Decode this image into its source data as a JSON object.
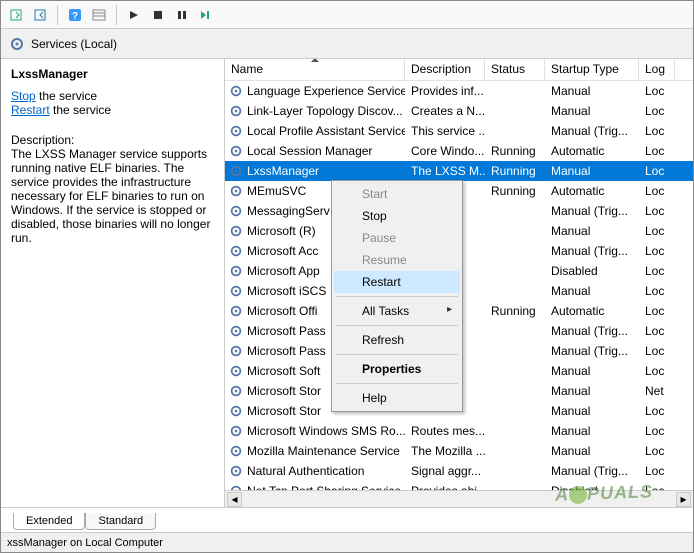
{
  "toolbar": {
    "icons": [
      "export",
      "import",
      "sep",
      "help",
      "props",
      "sep",
      "play",
      "stop",
      "pause",
      "restart"
    ]
  },
  "header": {
    "title": "Services (Local)"
  },
  "left": {
    "title": "LxssManager",
    "stop_label": "Stop",
    "stop_suffix": " the service",
    "restart_label": "Restart",
    "restart_suffix": " the service",
    "desc_label": "Description:",
    "desc_text": "The LXSS Manager service supports running native ELF binaries. The service provides the infrastructure necessary for ELF binaries to run on Windows. If the service is stopped or disabled, those binaries will no longer run."
  },
  "columns": [
    "Name",
    "Description",
    "Status",
    "Startup Type",
    "Log"
  ],
  "rows": [
    {
      "name": "Language Experience Service",
      "desc": "Provides inf...",
      "status": "",
      "startup": "Manual",
      "log": "Loc"
    },
    {
      "name": "Link-Layer Topology Discov...",
      "desc": "Creates a N...",
      "status": "",
      "startup": "Manual",
      "log": "Loc"
    },
    {
      "name": "Local Profile Assistant Service",
      "desc": "This service ...",
      "status": "",
      "startup": "Manual (Trig...",
      "log": "Loc"
    },
    {
      "name": "Local Session Manager",
      "desc": "Core Windo...",
      "status": "Running",
      "startup": "Automatic",
      "log": "Loc"
    },
    {
      "name": "LxssManager",
      "desc": "The LXSS M...",
      "status": "Running",
      "startup": "Manual",
      "log": "Loc",
      "selected": true
    },
    {
      "name": "MEmuSVC",
      "desc": "",
      "status": "Running",
      "startup": "Automatic",
      "log": "Loc"
    },
    {
      "name": "MessagingServ",
      "desc": "",
      "status": "",
      "startup": "Manual (Trig...",
      "log": "Loc"
    },
    {
      "name": "Microsoft (R) ",
      "desc": "",
      "status": "",
      "startup": "Manual",
      "log": "Loc"
    },
    {
      "name": "Microsoft Acc",
      "desc": "",
      "status": "",
      "startup": "Manual (Trig...",
      "log": "Loc"
    },
    {
      "name": "Microsoft App",
      "desc": "",
      "status": "",
      "startup": "Disabled",
      "log": "Loc"
    },
    {
      "name": "Microsoft iSCS",
      "desc": "",
      "status": "",
      "startup": "Manual",
      "log": "Loc"
    },
    {
      "name": "Microsoft Offi",
      "desc": "",
      "status": "Running",
      "startup": "Automatic",
      "log": "Loc"
    },
    {
      "name": "Microsoft Pass",
      "desc": "",
      "status": "",
      "startup": "Manual (Trig...",
      "log": "Loc"
    },
    {
      "name": "Microsoft Pass",
      "desc": "",
      "status": "",
      "startup": "Manual (Trig...",
      "log": "Loc"
    },
    {
      "name": "Microsoft Soft",
      "desc": "",
      "status": "",
      "startup": "Manual",
      "log": "Loc"
    },
    {
      "name": "Microsoft Stor",
      "desc": "",
      "status": "",
      "startup": "Manual",
      "log": "Net"
    },
    {
      "name": "Microsoft Stor",
      "desc": "",
      "status": "",
      "startup": "Manual",
      "log": "Loc"
    },
    {
      "name": "Microsoft Windows SMS Ro...",
      "desc": "Routes mes...",
      "status": "",
      "startup": "Manual",
      "log": "Loc"
    },
    {
      "name": "Mozilla Maintenance Service",
      "desc": "The Mozilla ...",
      "status": "",
      "startup": "Manual",
      "log": "Loc"
    },
    {
      "name": "Natural Authentication",
      "desc": "Signal aggr...",
      "status": "",
      "startup": "Manual (Trig...",
      "log": "Loc"
    },
    {
      "name": "Net.Tcp Port Sharing Service",
      "desc": "Provides abi...",
      "status": "",
      "startup": "Disabled",
      "log": "Loc"
    }
  ],
  "context_menu": {
    "start": "Start",
    "stop": "Stop",
    "pause": "Pause",
    "resume": "Resume",
    "restart": "Restart",
    "all_tasks": "All Tasks",
    "refresh": "Refresh",
    "properties": "Properties",
    "help": "Help"
  },
  "tabs": {
    "extended": "Extended",
    "standard": "Standard"
  },
  "status_bar": "xssManager on Local Computer",
  "watermark": "A  PUALS"
}
